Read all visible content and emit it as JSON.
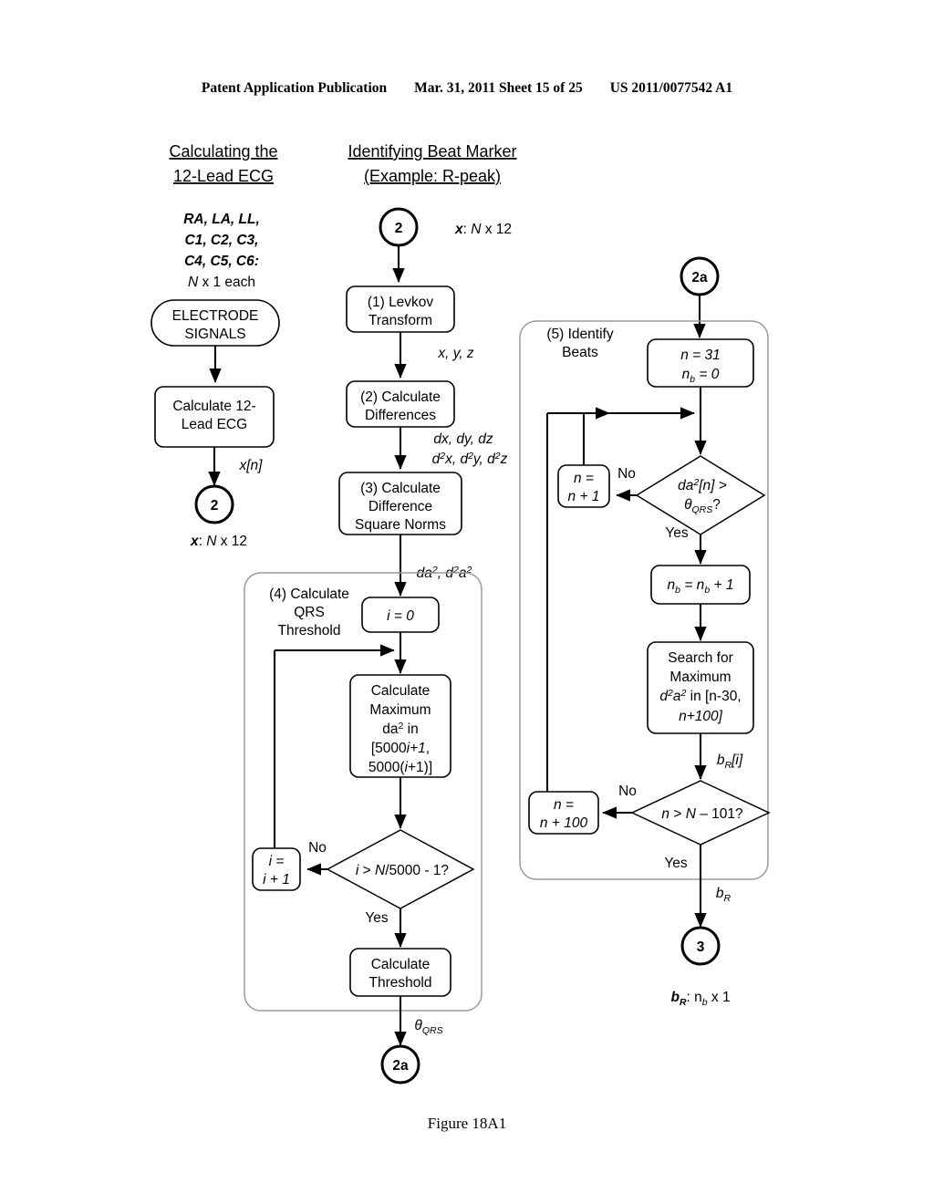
{
  "header": {
    "publication": "Patent Application Publication",
    "date": "Mar. 31, 2011",
    "sheet": "Sheet 15 of 25",
    "number": "US 2011/0077542 A1"
  },
  "caption": "Figure 18A1",
  "columns": {
    "left_title_line1": "Calculating the",
    "left_title_line2": "12-Lead ECG",
    "mid_title_line1": "Identifying Beat Marker",
    "mid_title_line2": "(Example: R-peak)"
  },
  "left": {
    "inputs_l1": "RA, LA, LL,",
    "inputs_l2": "C1, C2, C3,",
    "inputs_l3": "C4, C5, C6:",
    "inputs_l4_n": "N",
    "inputs_l4_rest": " x 1 each",
    "terminal_l1": "ELECTRODE",
    "terminal_l2": "SIGNALS",
    "process_l1": "Calculate 12-",
    "process_l2": "Lead ECG",
    "edge_label": "x[n]",
    "connector": "2",
    "output_var": "x",
    "output_dim_n": "N",
    "output_dim_rest": " x 12"
  },
  "mid": {
    "connector_in": "2",
    "connector_in_label_var": "x",
    "connector_in_label_n": "N",
    "connector_in_label_rest": " x 12",
    "step1_l1": "(1) Levkov",
    "step1_l2": "Transform",
    "edge1": "x, y, z",
    "step2_l1": "(2) Calculate",
    "step2_l2": "Differences",
    "edge2_l1": "dx, dy, dz",
    "edge2_l2_a": "d",
    "edge2_l2_sup": "2",
    "edge2_l2_b": "x, d",
    "edge2_l2_c": "y, d",
    "edge2_l2_d": "z",
    "step3_l1": "(3) Calculate",
    "step3_l2": "Difference",
    "step3_l3": "Square Norms",
    "edge3_a": "da",
    "edge3_sup": "2",
    "edge3_b": ", d",
    "edge3_c": "a",
    "group4_l1": "(4) Calculate",
    "group4_l2": "QRS",
    "group4_l3": "Threshold",
    "init": "i = 0",
    "calcmax_l1": "Calculate",
    "calcmax_l2": "Maximum",
    "calcmax_l3a": "da",
    "calcmax_l3sup": "2",
    "calcmax_l3b": " in",
    "calcmax_l4": "[5000i+1,",
    "calcmax_l5": "5000(i+1)]",
    "decision": "i > N/5000 - 1?",
    "no_label": "No",
    "yes_label": "Yes",
    "incr_l1": "i =",
    "incr_l2": "i + 1",
    "threshold_l1": "Calculate",
    "threshold_l2": "Threshold",
    "edge_out": "QRS",
    "edge_out_theta": "θ",
    "connector_out": "2a"
  },
  "right": {
    "connector_in": "2a",
    "group5_l1": "(5) Identify",
    "group5_l2": "Beats",
    "init_l1": "n = 31",
    "init_l2_n": "n",
    "init_l2_sub": "b",
    "init_l2_rest": " = 0",
    "decision1_l1a": "da",
    "decision1_l1sup": "2",
    "decision1_l1b": "[n] >",
    "decision1_l2theta": "θ",
    "decision1_l2sub": "QRS",
    "decision1_l2q": "?",
    "no_label": "No",
    "yes_label": "Yes",
    "incr1_l1": "n =",
    "incr1_l2": "n + 1",
    "count_a": "n",
    "count_sub": "b",
    "count_b": " = n",
    "count_c": " + 1",
    "search_l1": "Search for",
    "search_l2": "Maximum",
    "search_l3a": "d",
    "search_l3sup": "2",
    "search_l3b": "a",
    "search_l3c": " in [n-30,",
    "search_l4": "n+100]",
    "edge_br_a": "b",
    "edge_br_sub": "R",
    "edge_br_b": "[i]",
    "decision2": "n > N – 101?",
    "incr2_l1": "n =",
    "incr2_l2": "n + 100",
    "edge_out_a": "b",
    "edge_out_sub": "R",
    "connector_out": "3",
    "result_var": "b",
    "result_sub": "R",
    "result_colon": ":  n",
    "result_sub2": "b",
    "result_rest": " x 1"
  }
}
